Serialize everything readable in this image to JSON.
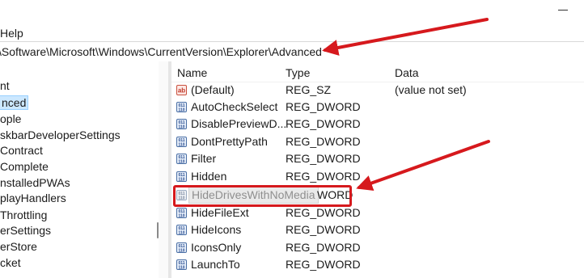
{
  "menu": {
    "help_label": "Help"
  },
  "address": {
    "path": "\\Software\\Microsoft\\Windows\\CurrentVersion\\Explorer\\Advanced"
  },
  "tree": {
    "items": [
      {
        "label": "nt",
        "selected": false
      },
      {
        "label": "nced",
        "selected": true
      },
      {
        "label": "ople",
        "selected": false
      },
      {
        "label": "skbarDeveloperSettings",
        "selected": false
      },
      {
        "label": "Contract",
        "selected": false
      },
      {
        "label": "Complete",
        "selected": false
      },
      {
        "label": "nstalledPWAs",
        "selected": false
      },
      {
        "label": "playHandlers",
        "selected": false
      },
      {
        "label": "Throttling",
        "selected": false
      },
      {
        "label": "erSettings",
        "selected": false
      },
      {
        "label": "erStore",
        "selected": false
      },
      {
        "label": "cket",
        "selected": false
      }
    ]
  },
  "list": {
    "headers": {
      "name": "Name",
      "type": "Type",
      "data": "Data"
    },
    "rows": [
      {
        "name": "(Default)",
        "type": "REG_SZ",
        "data": "(value not set)",
        "icon": "string-value-icon"
      },
      {
        "name": "AutoCheckSelect",
        "type": "REG_DWORD",
        "data": "",
        "icon": "dword-value-icon"
      },
      {
        "name": "DisablePreviewD...",
        "type": "REG_DWORD",
        "data": "",
        "icon": "dword-value-icon"
      },
      {
        "name": "DontPrettyPath",
        "type": "REG_DWORD",
        "data": "",
        "icon": "dword-value-icon"
      },
      {
        "name": "Filter",
        "type": "REG_DWORD",
        "data": "",
        "icon": "dword-value-icon"
      },
      {
        "name": "Hidden",
        "type": "REG_DWORD",
        "data": "",
        "icon": "dword-value-icon"
      },
      {
        "name": "HideDrivesWithNoMedia",
        "type": "WORD",
        "data": "",
        "icon": "dword-value-icon",
        "highlighted": true
      },
      {
        "name": "HideFileExt",
        "type": "REG_DWORD",
        "data": "",
        "icon": "dword-value-icon"
      },
      {
        "name": "HideIcons",
        "type": "REG_DWORD",
        "data": "",
        "icon": "dword-value-icon"
      },
      {
        "name": "IconsOnly",
        "type": "REG_DWORD",
        "data": "",
        "icon": "dword-value-icon"
      },
      {
        "name": "LaunchTo",
        "type": "REG_DWORD",
        "data": "",
        "icon": "dword-value-icon"
      }
    ]
  },
  "colors": {
    "annotation": "#d6191d",
    "selection": "#cce8ff"
  }
}
